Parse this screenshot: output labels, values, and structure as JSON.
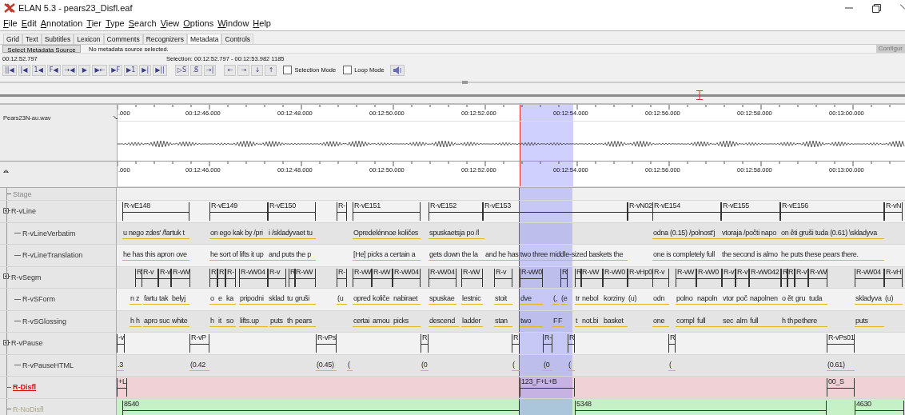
{
  "window": {
    "title": "ELAN 5.3 - pears23_Disfl.eaf"
  },
  "menu": [
    "File",
    "Edit",
    "Annotation",
    "Tier",
    "Type",
    "Search",
    "View",
    "Options",
    "Window",
    "Help"
  ],
  "tabs": [
    {
      "label": "Grid",
      "selected": false
    },
    {
      "label": "Text",
      "selected": false
    },
    {
      "label": "Subtitles",
      "selected": false
    },
    {
      "label": "Lexicon",
      "selected": false
    },
    {
      "label": "Comments",
      "selected": false
    },
    {
      "label": "Recognizers",
      "selected": false
    },
    {
      "label": "Metadata",
      "selected": true
    },
    {
      "label": "Controls",
      "selected": false
    }
  ],
  "metadata": {
    "button": "Select Metadata Source",
    "message": "No metadata source selected.",
    "configure": "Configur"
  },
  "player": {
    "time": "00:12:52.797",
    "selection": "Selection: 00:12:52.797 - 00:12:53.982  1185",
    "buttons": [
      "||◀",
      "|◀",
      "1◀",
      "F◀",
      "→◀",
      "▶",
      "▶←",
      "▶F",
      "▶1",
      "▶|",
      "▶||"
    ],
    "edit_buttons": [
      "▷S",
      "S̸",
      "→|"
    ],
    "nav_buttons": [
      "←",
      "→",
      "↓",
      "↑"
    ],
    "modes": [
      {
        "label": "Selection Mode",
        "checked": false
      },
      {
        "label": "Loop Mode",
        "checked": false
      }
    ]
  },
  "media": {
    "file": "Pears23N-au.wav"
  },
  "ruler_top": [
    ".000",
    "00:12:46.000",
    "00:12:48.000",
    "00:12:50.000",
    "00:12:52.000",
    "00:12:54.000",
    "00:12:56.000",
    "00:12:58.000",
    "00:13:00.000"
  ],
  "ruler_bottom": [
    ".000",
    "00:12:46.000",
    "00:12:48.000",
    "00:12:50.000",
    "00:12:52.000",
    "00:12:54.000",
    "00:12:56.000",
    "00:12:58.000",
    "00:13:00.000"
  ],
  "tiers": [
    {
      "name": "Stage",
      "kind": "stage",
      "active": false,
      "greyed": false,
      "color": "#f0f0f0"
    },
    {
      "name": "R-vLine",
      "kind": "parent",
      "active": false,
      "greyed": false,
      "color": "#f2f2f2",
      "annotations": [
        "R-vE148",
        "R-vE149",
        "R-vE150",
        "R-",
        "R-vE151",
        "R-vE152",
        "R-vE153",
        "R-vN02",
        "R-vE154",
        "R-vE155",
        "R-vE156",
        "R-vN"
      ]
    },
    {
      "name": "R-vLineVerbatim",
      "kind": "child",
      "active": false,
      "greyed": false,
      "color": "#e4e4e4",
      "annotations": [
        "u nego zdes' /fartuk t",
        "on ego kak by /pri",
        "i /skladyvaet tu",
        "Opredelénnoe količes",
        "spuskaetsja po /l",
        "odna (0.15) /polnost'j",
        "vtoraja /počti napo",
        "on ěti gruši tuda (0.61) \\skladyva"
      ]
    },
    {
      "name": "R-vLineTranslation",
      "kind": "child",
      "active": false,
      "greyed": false,
      "color": "#f2f2f2",
      "annotations": [
        "he has this apron ove",
        "he sort of lifts it up",
        "and puts the p",
        "[He] picks a certain a",
        "gets down the la",
        "and he has two three middle-sized baskets the",
        "one is completely full",
        "the second is almo",
        "he puts these pears there."
      ]
    },
    {
      "name": "R-vSegm",
      "kind": "parent",
      "active": false,
      "greyed": false,
      "color": "#e4e4e4",
      "annotations": [
        "R",
        "R-v",
        "R-v",
        "R-vW",
        "R",
        "R",
        "R-",
        "R-vW04",
        "R-v",
        "R",
        "R-vW",
        "R-",
        "R-vW",
        "R-vW",
        "R-vW04",
        "R-vW04",
        "R-vW",
        "R-v",
        "R-vW0",
        "R",
        "R",
        "R-vW",
        "R-vW0",
        "R-vHp0",
        "R-v",
        "R-vW",
        "R-vW0",
        "R-v",
        "R-v",
        "R-vW042",
        "R",
        "R",
        "R-v",
        "R-vW",
        "R-vW04",
        "R-vH"
      ]
    },
    {
      "name": "R-vSForm",
      "kind": "child",
      "active": false,
      "greyed": false,
      "color": "#f2f2f2",
      "annotations": [
        "n",
        "z",
        "fartu",
        "tak",
        "belyj",
        "o",
        "e",
        "ka",
        "pripodni",
        "sklad",
        "tu",
        "gruši",
        "(u",
        "opred",
        "količe",
        "nabiraet",
        "spuskae",
        "lestnic",
        "stoit",
        "dve",
        "(,",
        "(e",
        "tr",
        "nebol",
        "korziny",
        "(u)",
        "odn",
        "polno",
        "napoln",
        "vtor",
        "poč",
        "napolnen",
        "o",
        "ět",
        "gru",
        "tuda",
        "skladyva",
        "(u)"
      ]
    },
    {
      "name": "R-vSGlossing",
      "kind": "child",
      "active": false,
      "greyed": false,
      "color": "#e4e4e4",
      "annotations": [
        "h",
        "h",
        "apro",
        "suc",
        "white",
        "h",
        "it",
        "so",
        "lifts.up",
        "puts",
        "th",
        "pears",
        "certai",
        "amou",
        "picks",
        "descend",
        "ladder",
        "stan",
        "two",
        "F",
        "F",
        "t",
        "not.bi",
        "basket",
        "one",
        "compl",
        "full",
        "sec",
        "alm",
        "full",
        "h",
        "th",
        "pe",
        "there",
        "puts"
      ]
    },
    {
      "name": "R-vPause",
      "kind": "parent",
      "active": false,
      "greyed": false,
      "color": "#f2f2f2",
      "annotations": [
        "-v",
        "R-vP",
        "R-vPs",
        "R",
        "R",
        "R-",
        "R",
        "R",
        "R-vPs01"
      ]
    },
    {
      "name": "R-vPauseHTML",
      "kind": "child",
      "active": false,
      "greyed": false,
      "color": "#e4e4e4",
      "annotations": [
        ".3",
        "(0.42",
        "(0.45)",
        "(",
        "(0",
        "(",
        "(0",
        "(",
        "(",
        "(0.61)"
      ]
    },
    {
      "name": "R-Disfl",
      "kind": "leaf",
      "active": true,
      "greyed": false,
      "color": "#f0d2d6",
      "annotations": [
        "+L",
        "123_F+L+B",
        "00_S"
      ]
    },
    {
      "name": "R-NoDisfl",
      "kind": "leaf",
      "active": false,
      "greyed": true,
      "color": "#c6f0c6",
      "annotations": [
        "8540",
        "5348",
        "4630"
      ]
    }
  ]
}
